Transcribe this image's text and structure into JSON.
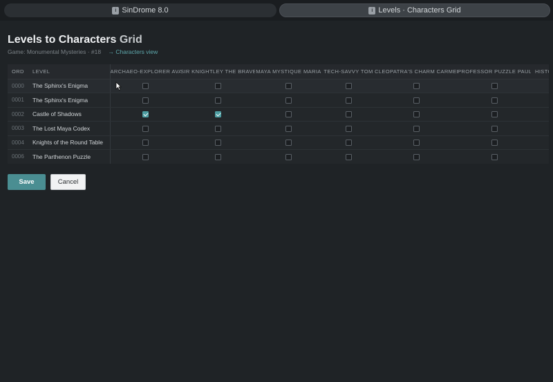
{
  "tabs": [
    {
      "icon": "app-icon",
      "label": "SinDrome 8.0"
    },
    {
      "icon": "page-icon",
      "label": "Levels · Characters Grid"
    }
  ],
  "title": {
    "main": "Levels to Characters",
    "accent": "Grid"
  },
  "subtitle": {
    "text": "Game: Monumental Mysteries · #18",
    "link": "→ Characters view"
  },
  "grid": {
    "columns": {
      "ord": "ORD",
      "level": "LEVEL",
      "characters": [
        "ARCHAEO-EXPLORER AVA",
        "SIR KNIGHTLEY THE BRAVE",
        "MAYA MYSTIQUE MARIA",
        "TECH-SAVVY TOM",
        "CLEOPATRA'S CHARM CARMEN",
        "PROFESSOR PUZZLE PAUL",
        "HISTO"
      ]
    },
    "rows": [
      {
        "ord": "0000",
        "level": "The Sphinx's Enigma",
        "checks": [
          false,
          false,
          false,
          false,
          false,
          false
        ]
      },
      {
        "ord": "0001",
        "level": "The Sphinx's Enigma",
        "checks": [
          false,
          false,
          false,
          false,
          false,
          false
        ]
      },
      {
        "ord": "0002",
        "level": "Castle of Shadows",
        "checks": [
          true,
          true,
          false,
          false,
          false,
          false
        ]
      },
      {
        "ord": "0003",
        "level": "The Lost Maya Codex",
        "checks": [
          false,
          false,
          false,
          false,
          false,
          false
        ]
      },
      {
        "ord": "0004",
        "level": "Knights of the Round Table",
        "checks": [
          false,
          false,
          false,
          false,
          false,
          false
        ]
      },
      {
        "ord": "0006",
        "level": "The Parthenon Puzzle",
        "checks": [
          false,
          false,
          false,
          false,
          false,
          false
        ]
      }
    ]
  },
  "buttons": {
    "save": "Save",
    "cancel": "Cancel"
  },
  "colors": {
    "accent": "#4d9ea2",
    "save_bg": "#4a8e92",
    "background": "#1f2326"
  }
}
